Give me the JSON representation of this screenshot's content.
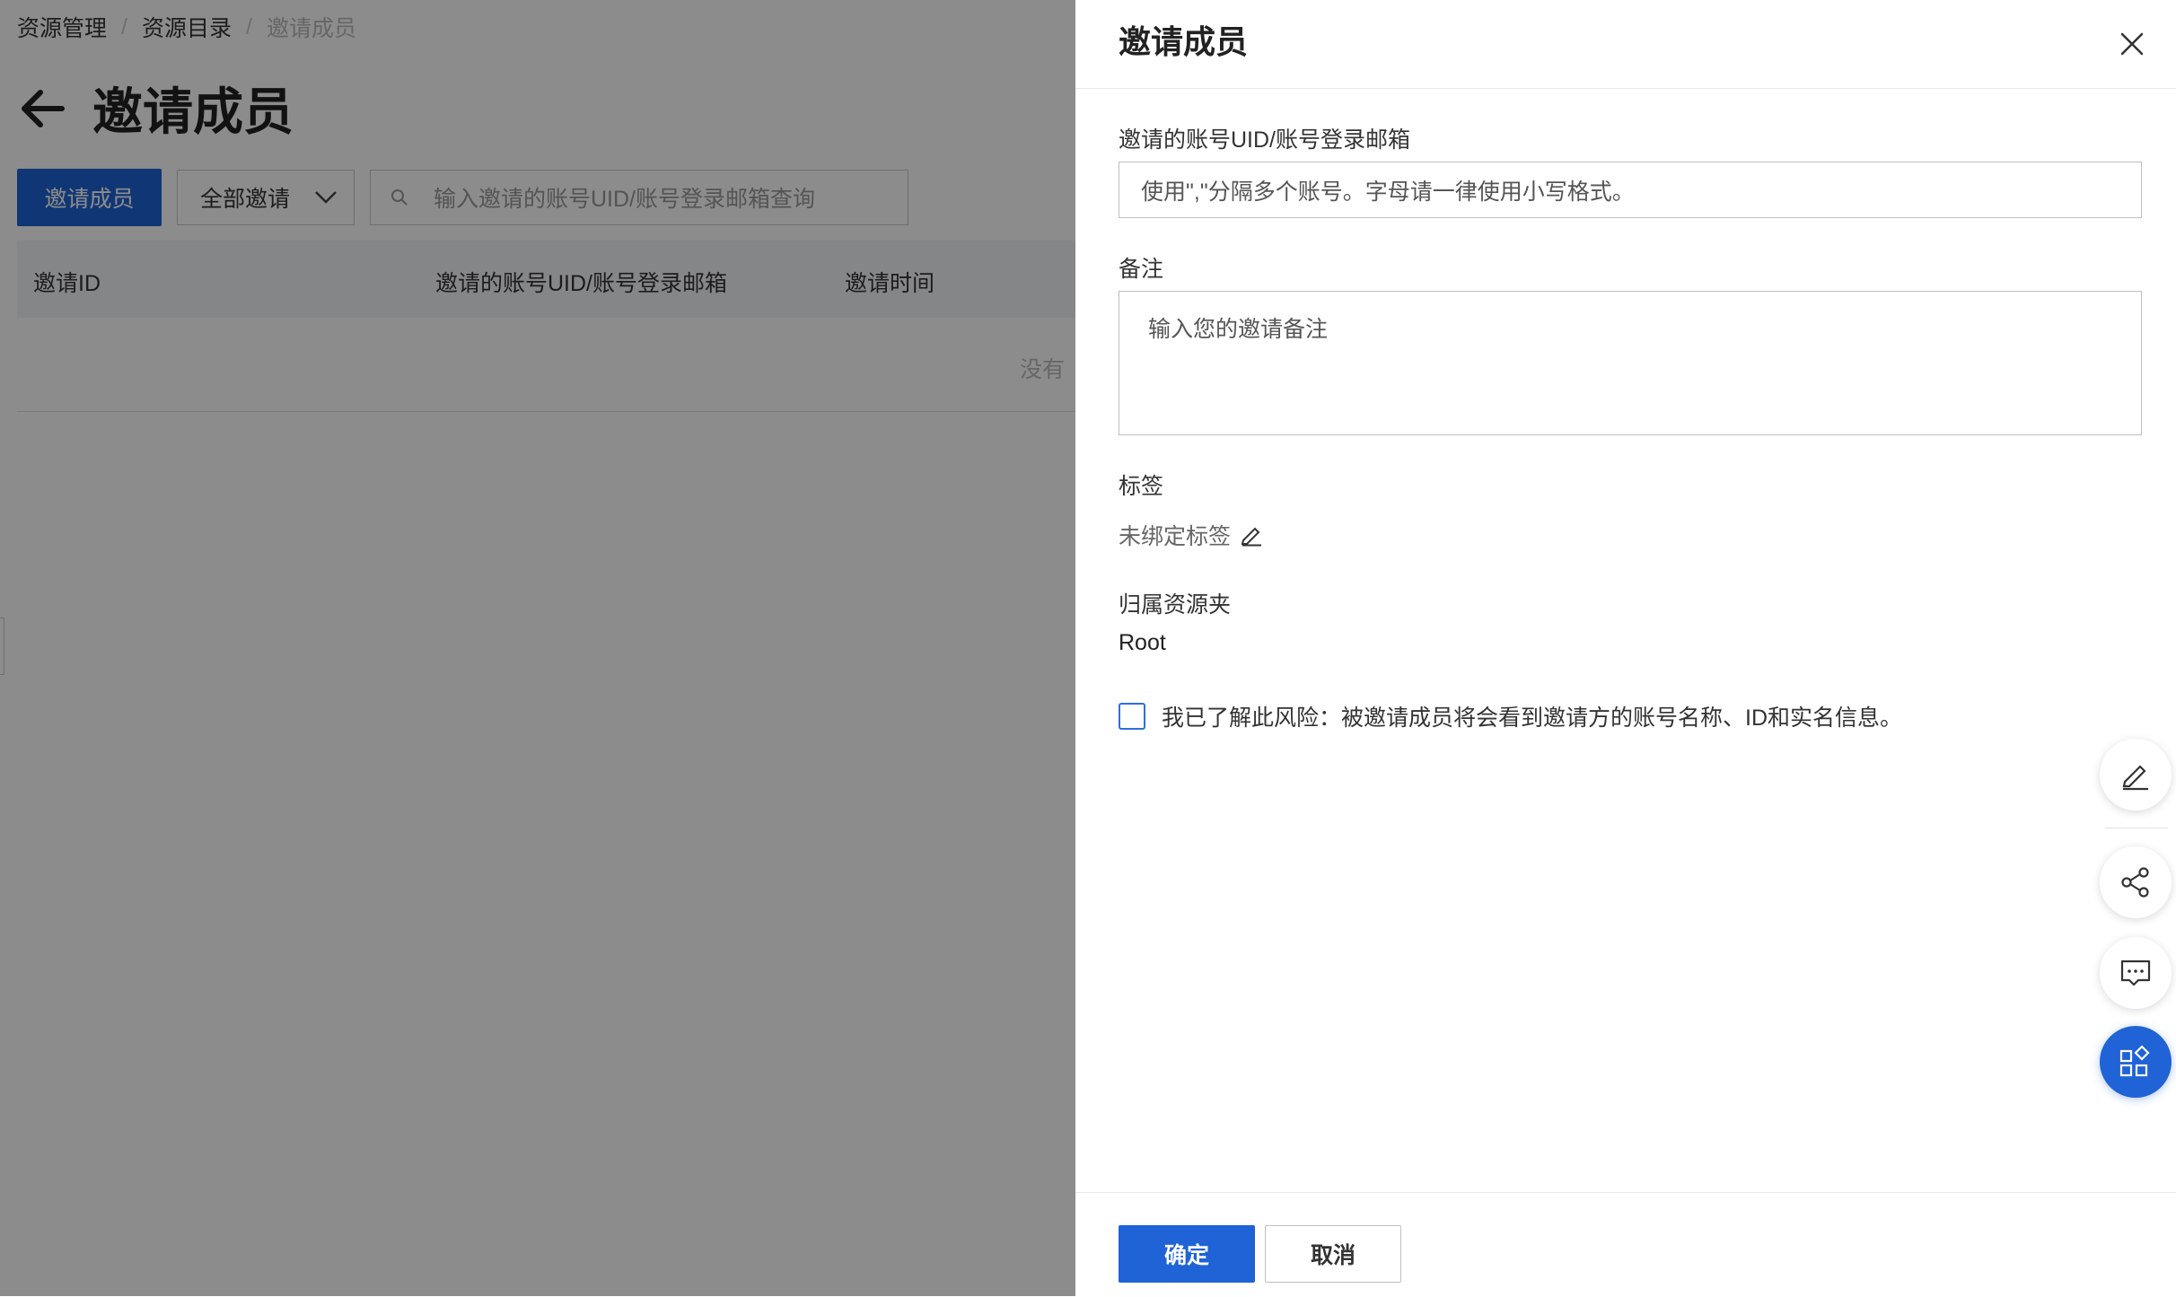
{
  "breadcrumb": {
    "items": [
      "资源管理",
      "资源目录"
    ],
    "current": "邀请成员",
    "separator": "/"
  },
  "page": {
    "title": "邀请成员",
    "invite_button": "邀请成员",
    "filter_select": "全部邀请",
    "search_placeholder": "输入邀请的账号UID/账号登录邮箱查询",
    "table_columns": [
      "邀请ID",
      "邀请的账号UID/账号登录邮箱",
      "邀请时间"
    ],
    "empty_text": "没有"
  },
  "drawer": {
    "title": "邀请成员",
    "account_label": "邀请的账号UID/账号登录邮箱",
    "account_placeholder": "使用\",\"分隔多个账号。字母请一律使用小写格式。",
    "note_label": "备注",
    "note_placeholder": "输入您的邀请备注",
    "tag_label": "标签",
    "tag_value": "未绑定标签",
    "folder_label": "归属资源夹",
    "folder_value": "Root",
    "risk_ack": "我已了解此风险：被邀请成员将会看到邀请方的账号名称、ID和实名信息。",
    "confirm_button": "确定",
    "cancel_button": "取消"
  },
  "float_tools": [
    "edit-icon",
    "share-icon",
    "feedback-icon",
    "apps-icon"
  ],
  "colors": {
    "primary": "#1f63d6",
    "overlay": "rgba(0,0,0,0.45)"
  }
}
